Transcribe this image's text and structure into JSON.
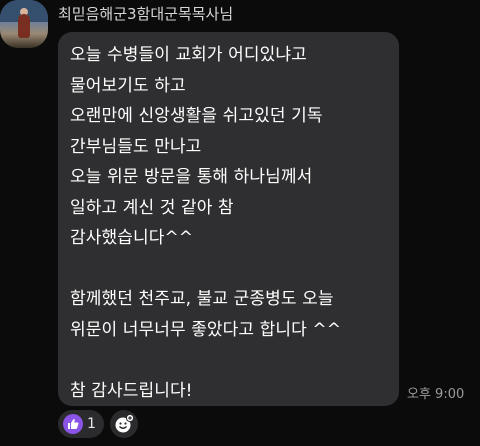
{
  "sender": {
    "name": "최믿음해군3함대군목목사님"
  },
  "message": {
    "lines": [
      "오늘 수병들이 교회가 어디있냐고",
      "물어보기도 하고",
      "오랜만에 신앙생활을 쉬고있던 기독",
      "간부님들도 만나고",
      "오늘 위문 방문을 통해 하나님께서",
      "일하고 계신 것 같아 참",
      "감사했습니다^^",
      "",
      "함께했던 천주교, 불교 군종병도 오늘",
      "위문이 너무너무 좋았다고 합니다 ^^",
      "",
      "참 감사드립니다!"
    ],
    "time": "오후 9:00"
  },
  "reactions": {
    "like_icon": "thumbs-up-icon",
    "like_count": "1",
    "add_icon": "smiley-plus-icon"
  },
  "colors": {
    "background": "#0b0b0b",
    "bubble": "#2f2f31",
    "reaction_accent": "#8a55e6"
  }
}
